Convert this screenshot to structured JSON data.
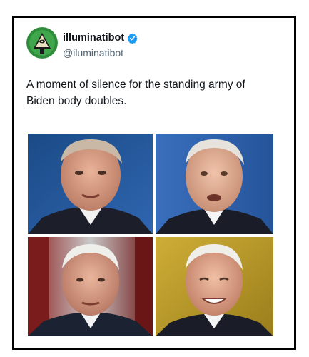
{
  "tweet": {
    "display_name": "illuminatibot",
    "handle": "@iluminatibot",
    "verified": true,
    "text": "A moment of silence for the standing army of Biden body doubles.",
    "avatar_icon": "pyramid-eye-icon",
    "verified_icon": "verified-badge-icon",
    "accent_color": "#1d9bf0"
  },
  "photos": [
    {
      "name": "photo-top-left",
      "background": "#1f4f8f"
    },
    {
      "name": "photo-top-right",
      "background": "#2a5ea8"
    },
    {
      "name": "photo-bottom-left",
      "background": "#7a1e1e"
    },
    {
      "name": "photo-bottom-right",
      "background": "#b89a26"
    }
  ]
}
